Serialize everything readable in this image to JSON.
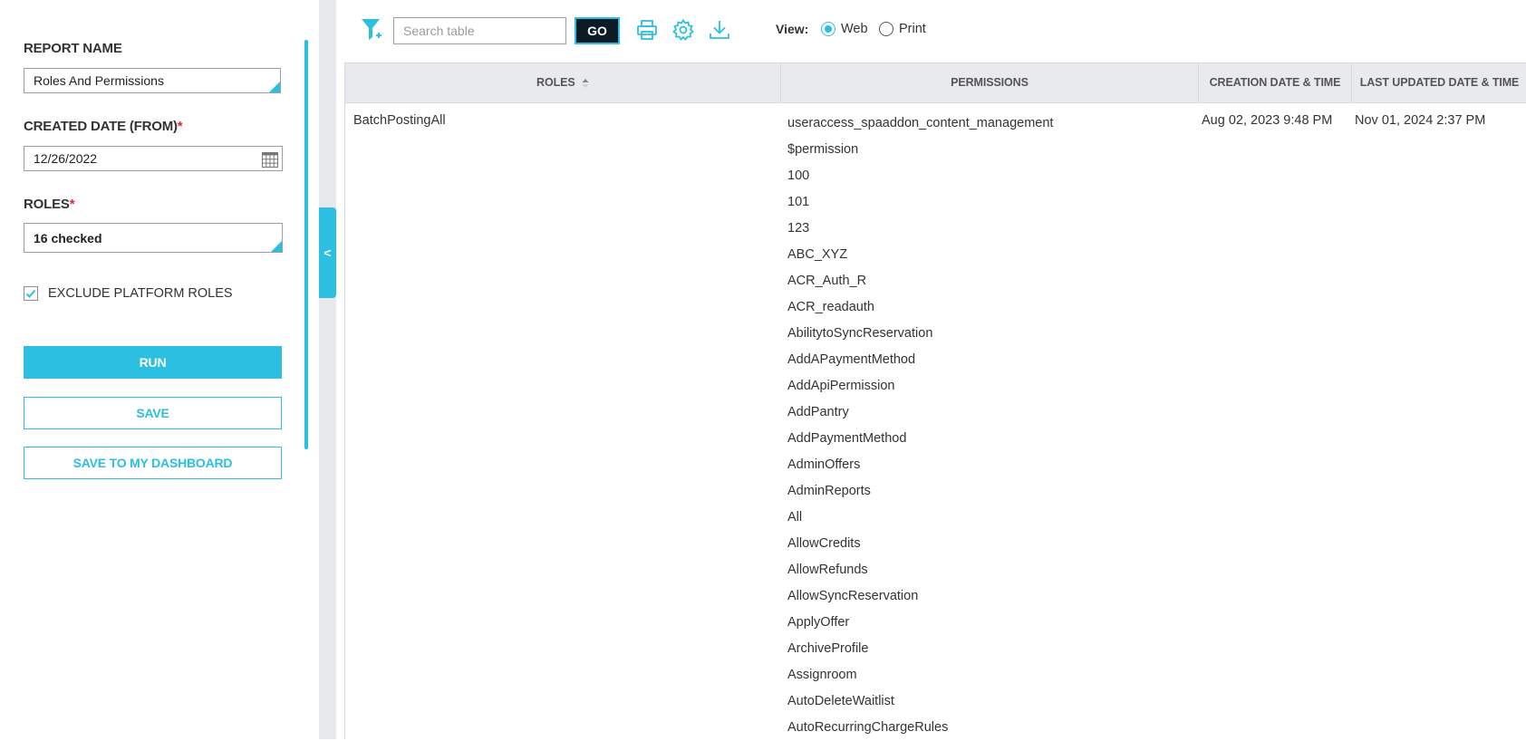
{
  "sidebar": {
    "report_name_label": "REPORT NAME",
    "report_name_value": "Roles And Permissions",
    "created_date_label": "CREATED DATE (FROM)",
    "created_date_value": "12/26/2022",
    "roles_label": "ROLES",
    "roles_value": "16 checked",
    "required_marker": "*",
    "exclude_platform_label": "EXCLUDE PLATFORM ROLES",
    "exclude_platform_checked": true,
    "run_label": "RUN",
    "save_label": "SAVE",
    "save_dashboard_label": "SAVE TO MY DASHBOARD",
    "collapse_label": "<"
  },
  "toolbar": {
    "search_placeholder": "Search table",
    "go_label": "GO",
    "view_label": "View:",
    "view_options": [
      {
        "label": "Web",
        "selected": true
      },
      {
        "label": "Print",
        "selected": false
      }
    ]
  },
  "table": {
    "columns": [
      "ROLES",
      "PERMISSIONS",
      "CREATION DATE & TIME",
      "LAST UPDATED DATE & TIME"
    ],
    "sorted_column": "ROLES",
    "rows": [
      {
        "role": "BatchPostingAll",
        "created": "Aug 02, 2023 9:48 PM",
        "updated": "Nov 01, 2024 2:37 PM",
        "permissions": [
          "useraccess_spaaddon_content_management",
          "$permission",
          "100",
          "101",
          "123",
          "ABC_XYZ",
          "ACR_Auth_R",
          "ACR_readauth",
          "AbilitytoSyncReservation",
          "AddAPaymentMethod",
          "AddApiPermission",
          "AddPantry",
          "AddPaymentMethod",
          "AdminOffers",
          "AdminReports",
          "All",
          "AllowCredits",
          "AllowRefunds",
          "AllowSyncReservation",
          "ApplyOffer",
          "ArchiveProfile",
          "Assignroom",
          "AutoDeleteWaitlist",
          "AutoRecurringChargeRules"
        ]
      }
    ]
  },
  "colors": {
    "accent": "#2bbfe2",
    "go_button_bg": "#0d1b26",
    "required": "#e0263b",
    "header_bg": "#e9eaed"
  }
}
